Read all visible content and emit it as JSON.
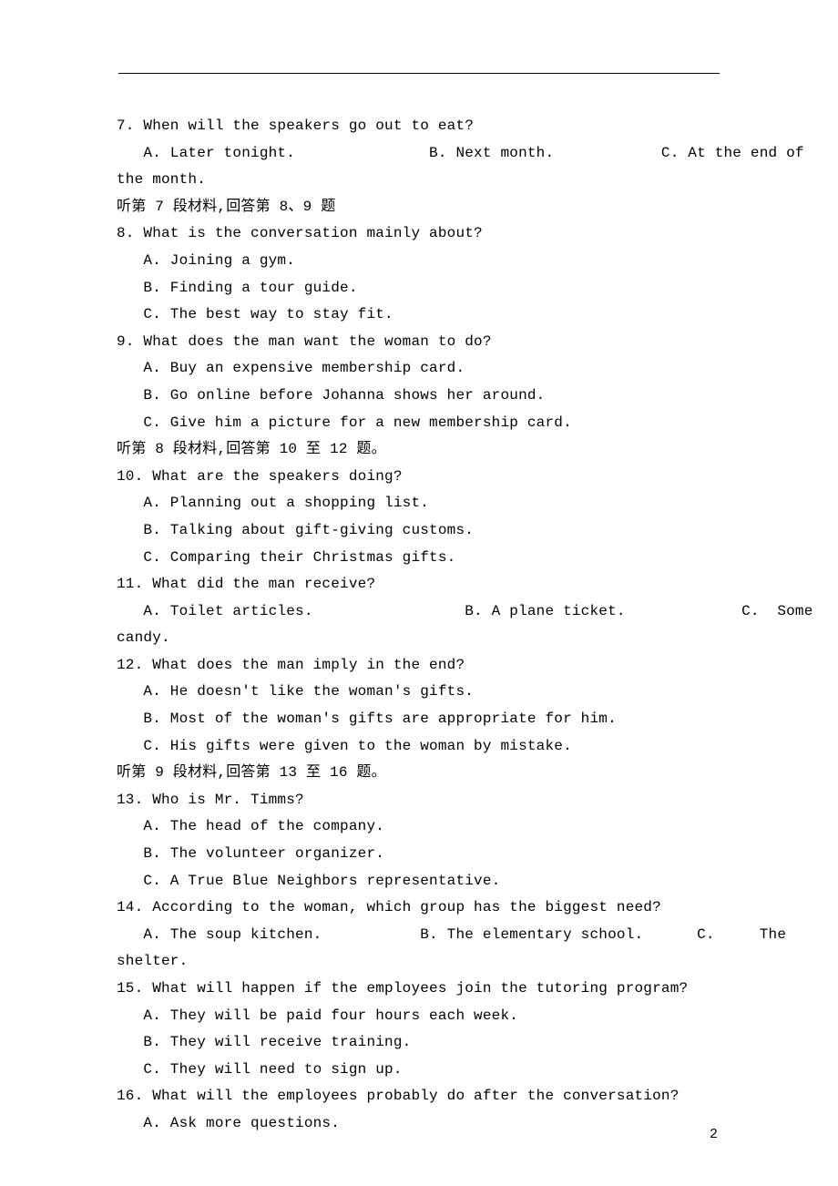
{
  "page_number": "2",
  "lines": {
    "q7": "7. When will the speakers go out to eat?",
    "q7_opts": "   A. Later tonight.               B. Next month.            C. At the end of",
    "q7_cont": "the month.",
    "heading7": "听第 7 段材料,回答第 8、9 题",
    "q8": "8. What is the conversation mainly about?",
    "q8_a": "   A. Joining a gym.",
    "q8_b": "   B. Finding a tour guide.",
    "q8_c": "   C. The best way to stay fit.",
    "q9": "9. What does the man want the woman to do?",
    "q9_a": "   A. Buy an expensive membership card.",
    "q9_b": "   B. Go online before Johanna shows her around.",
    "q9_c": "   C. Give him a picture for a new membership card.",
    "heading8": "听第 8 段材料,回答第 10 至 12 题。",
    "q10": "10. What are the speakers doing?",
    "q10_a": "   A. Planning out a shopping list.",
    "q10_b": "   B. Talking about gift-giving customs.",
    "q10_c": "   C. Comparing their Christmas gifts.",
    "q11": "11. What did the man receive?",
    "q11_opts": "   A. Toilet articles.                 B. A plane ticket.             C.  Some",
    "q11_cont": "candy.",
    "q12": "12. What does the man imply in the end?",
    "q12_a": "   A. He doesn't like the woman's gifts.",
    "q12_b": "   B. Most of the woman's gifts are appropriate for him.",
    "q12_c": "   C. His gifts were given to the woman by mistake.",
    "heading9": "听第 9 段材料,回答第 13 至 16 题。",
    "q13": "13. Who is Mr. Timms?",
    "q13_a": "   A. The head of the company.",
    "q13_b": "   B. The volunteer organizer.",
    "q13_c": "   C. A True Blue Neighbors representative.",
    "q14": "14. According to the woman, which group has the biggest need?",
    "q14_opts": "   A. The soup kitchen.           B. The elementary school.      C.     The",
    "q14_cont": "shelter.",
    "q15": "15. What will happen if the employees join the tutoring program?",
    "q15_a": "   A. They will be paid four hours each week.",
    "q15_b": "   B. They will receive training.",
    "q15_c": "   C. They will need to sign up.",
    "q16": "16. What will the employees probably do after the conversation?",
    "q16_a": "   A. Ask more questions."
  }
}
